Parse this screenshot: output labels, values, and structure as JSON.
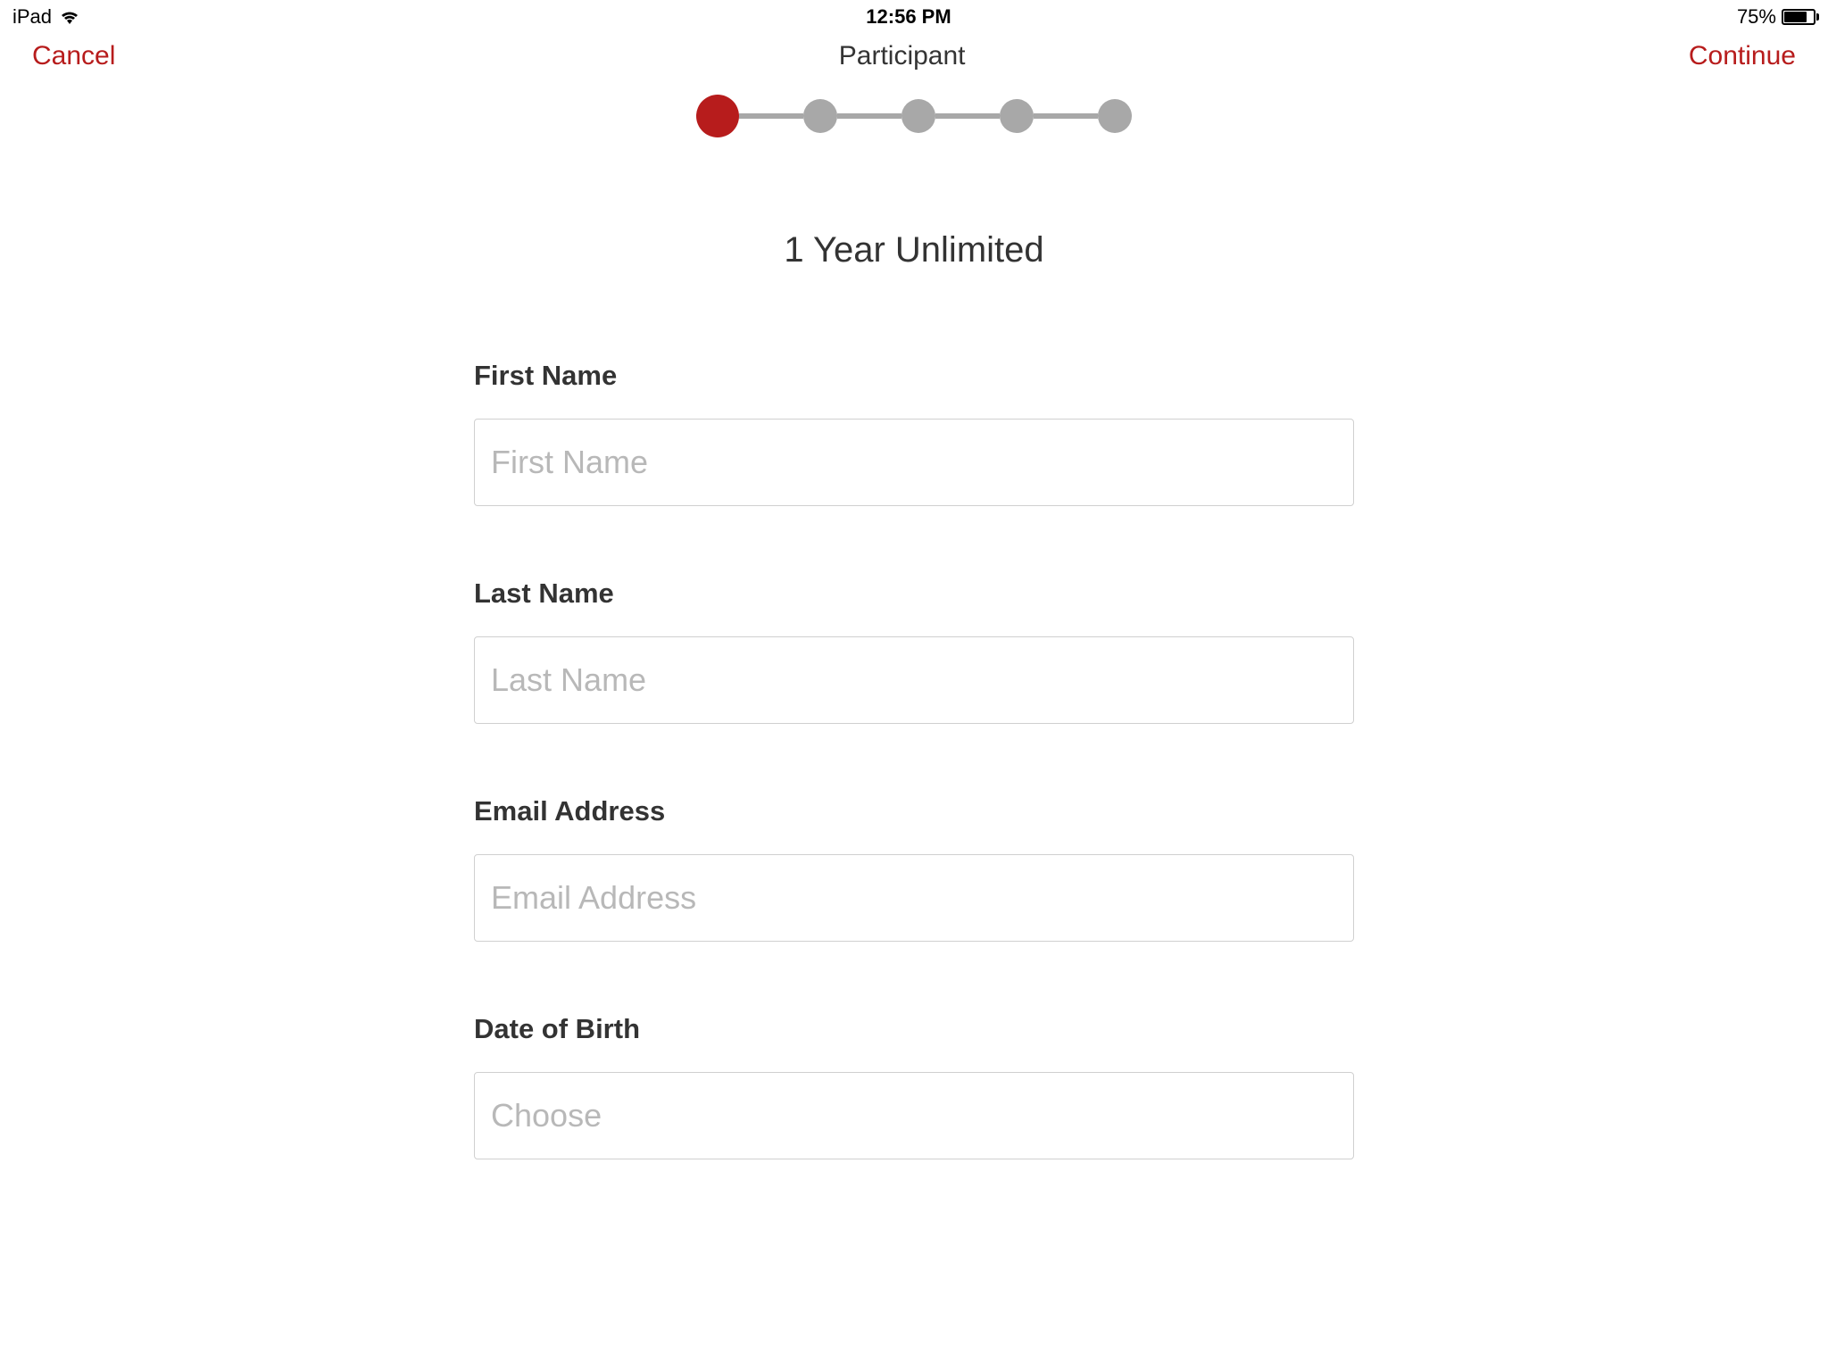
{
  "statusBar": {
    "deviceLabel": "iPad",
    "time": "12:56 PM",
    "batteryPercent": "75%"
  },
  "navBar": {
    "cancel": "Cancel",
    "title": "Participant",
    "continue": "Continue"
  },
  "progress": {
    "totalSteps": 5,
    "currentStep": 1
  },
  "subtitle": "1 Year Unlimited",
  "fields": {
    "firstName": {
      "label": "First Name",
      "placeholder": "First Name",
      "value": ""
    },
    "lastName": {
      "label": "Last Name",
      "placeholder": "Last Name",
      "value": ""
    },
    "email": {
      "label": "Email Address",
      "placeholder": "Email Address",
      "value": ""
    },
    "dob": {
      "label": "Date of Birth",
      "placeholder": "Choose",
      "value": ""
    }
  }
}
